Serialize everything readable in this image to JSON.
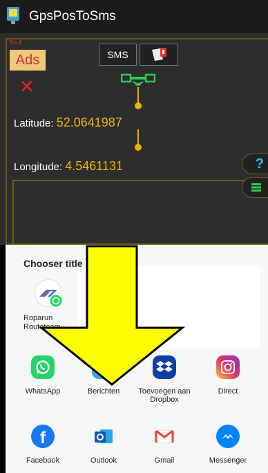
{
  "appbar": {
    "title": "GpsPosToSms"
  },
  "toolbar": {
    "ads_label": "Ads",
    "ads_tiny": "No  4",
    "sms_label": "SMS"
  },
  "close_label": "✕",
  "latitude": {
    "label": "Latitude:",
    "value": "52.0641987"
  },
  "longitude": {
    "label": "Longitude:",
    "value": "4.5461131"
  },
  "help_label": "?",
  "chooser": {
    "title": "Chooser title",
    "direct_share": {
      "label_line1": "Roparun",
      "label_line2": "Routeteam"
    }
  },
  "apps": [
    {
      "label": "WhatsApp",
      "color": "#25D366",
      "icon": "whatsapp-icon"
    },
    {
      "label": "Berichten",
      "color": "#3fa3e6",
      "icon": "messages-icon"
    },
    {
      "label": "Toevoegen aan Dropbox",
      "color": "#0061FF",
      "icon": "dropbox-icon"
    },
    {
      "label": "Direct",
      "color": "#c13584",
      "icon": "instagram-icon"
    },
    {
      "label": "Facebook",
      "color": "#1877F2",
      "icon": "facebook-icon"
    },
    {
      "label": "Outlook",
      "color": "#0078D4",
      "icon": "outlook-icon"
    },
    {
      "label": "Gmail",
      "color": "#EA4335",
      "icon": "gmail-icon"
    },
    {
      "label": "Messenger",
      "color": "#0084FF",
      "icon": "messenger-icon"
    }
  ],
  "overlay": {
    "arrow_color": "#ffff00"
  }
}
